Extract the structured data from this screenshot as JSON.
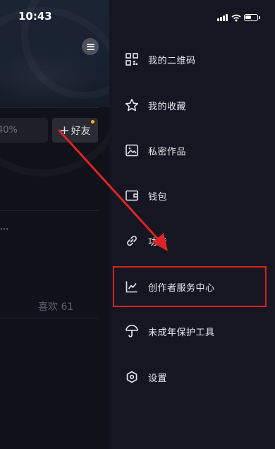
{
  "status_bar": {
    "time": "10:43"
  },
  "background_app": {
    "percent_text": "40%",
    "add_friend_label": "好友",
    "ellipsis": "…",
    "likes_label": "喜欢 61"
  },
  "drawer": {
    "items": [
      {
        "label": "我的二维码",
        "icon": "qr-code-icon"
      },
      {
        "label": "我的收藏",
        "icon": "star-icon"
      },
      {
        "label": "私密作品",
        "icon": "private-image-icon"
      },
      {
        "label": "钱包",
        "icon": "wallet-icon"
      },
      {
        "label": "功能",
        "icon": "link-icon"
      },
      {
        "label": "创作者服务中心",
        "icon": "chart-line-icon"
      },
      {
        "label": "未成年保护工具",
        "icon": "umbrella-icon"
      },
      {
        "label": "设置",
        "icon": "settings-hex-icon"
      }
    ]
  },
  "colors": {
    "highlight_box": "#d62020",
    "annotation_arrow": "#e02424",
    "drawer_bg": "#161622",
    "notification_dot": "#f5b800"
  }
}
